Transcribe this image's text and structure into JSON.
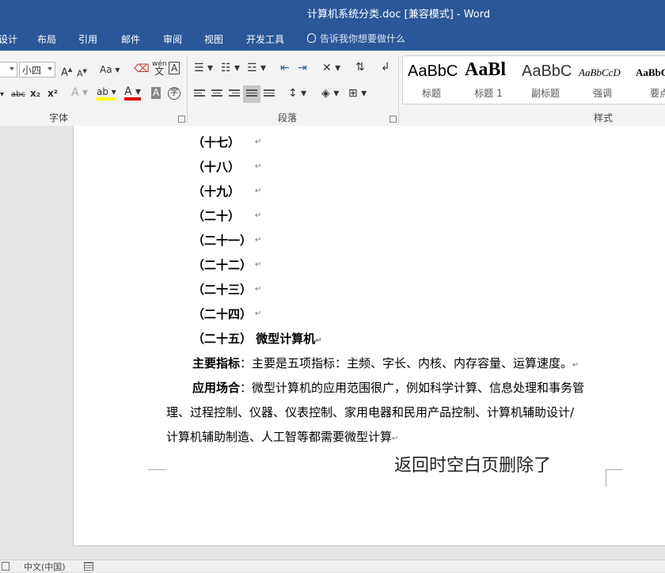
{
  "window": {
    "title": "计算机系统分类.doc [兼容模式] - Word"
  },
  "menu": {
    "tabs": [
      "设计",
      "布局",
      "引用",
      "邮件",
      "审阅",
      "视图",
      "开发工具"
    ],
    "tell_me": "告诉我你想要做什么"
  },
  "ribbon": {
    "font_size": "小四",
    "groups": {
      "font": "字体",
      "paragraph": "段落",
      "styles": "样式"
    },
    "styles": [
      {
        "sample": "AaBbC",
        "name": "标题"
      },
      {
        "sample": "AaBl",
        "name": "标题 1"
      },
      {
        "sample": "AaBbC",
        "name": "副标题"
      },
      {
        "sample": "AaBbCcD",
        "name": "强调"
      },
      {
        "sample": "AaBbC",
        "name": "要点"
      }
    ],
    "font_buttons": {
      "grow": "A",
      "shrink": "A",
      "case": "Aa",
      "phonetic": "wén",
      "phonetic_char": "文",
      "border_char": "A",
      "strike": "abc",
      "sub": "x₂",
      "sup": "x²",
      "effects": "A",
      "highlight": "ab",
      "font_color": "A",
      "shading": "A",
      "enclose": "字"
    }
  },
  "document": {
    "headings": [
      "（十七）",
      "（十八）",
      "（十九）",
      "（二十）",
      "（二十一）",
      "（二十二）",
      "（二十三）",
      "（二十四）"
    ],
    "heading_last": {
      "number": "（二十五）",
      "title": "微型计算机"
    },
    "main_label": "主要指标",
    "main_text": "：主要是五项指标：主频、字长、内核、内存容量、运算速度。",
    "app_label": "应用场合",
    "app_line1": "：微型计算机的应用范围很广，例如科学计算、信息处理和事务管",
    "app_line2": "理、过程控制、仪器、仪表控制、家用电器和民用产品控制、计算机辅助设计/",
    "app_line3": "计算机辅助制造、人工智等都需要微型计算",
    "para_mark": "↵"
  },
  "overlay_text": "返回时空白页删除了",
  "status": {
    "language": "中文(中国)"
  }
}
